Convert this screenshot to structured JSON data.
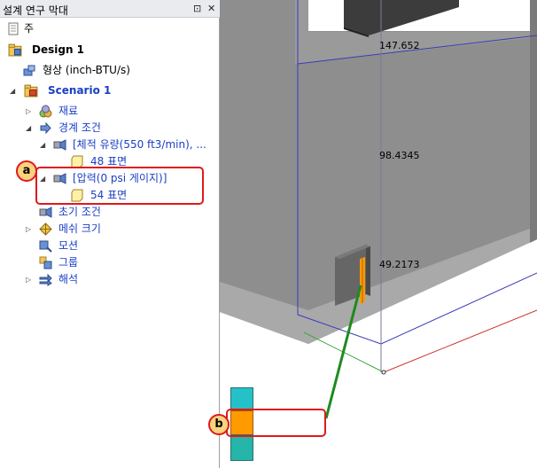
{
  "panel": {
    "title": "설계 연구 막대",
    "pin_glyph": "⊡",
    "close_glyph": "✕"
  },
  "tree": {
    "root": "주",
    "design": "Design 1",
    "geometry": "형상 (inch-BTU/s)",
    "scenario": "Scenario 1",
    "materials": "재료",
    "boundary": "경계 조건",
    "bc_volume_flow": "[체적 유량(550 ft3/min), ...",
    "bc_volume_faces": "48 표면",
    "bc_pressure": "[압력(0 psi 게이지)]",
    "bc_pressure_faces": "54 표면",
    "initial": "초기 조건",
    "mesh": "메쉬 크기",
    "motion": "모션",
    "groups": "그룹",
    "solve": "해석"
  },
  "callouts": {
    "a": "a",
    "b": "b"
  },
  "viewport": {
    "dim_top": "147.652",
    "dim_mid": "98.4345",
    "dim_bot": "49.2173"
  },
  "colors": {
    "callout_border": "#e0191b",
    "callout_fill": "#f9d37e",
    "leader_line": "#1f8a1f",
    "model_front": "#8c8c8c",
    "model_side": "#b0b0b0",
    "selected_face": "#ff9b00"
  }
}
